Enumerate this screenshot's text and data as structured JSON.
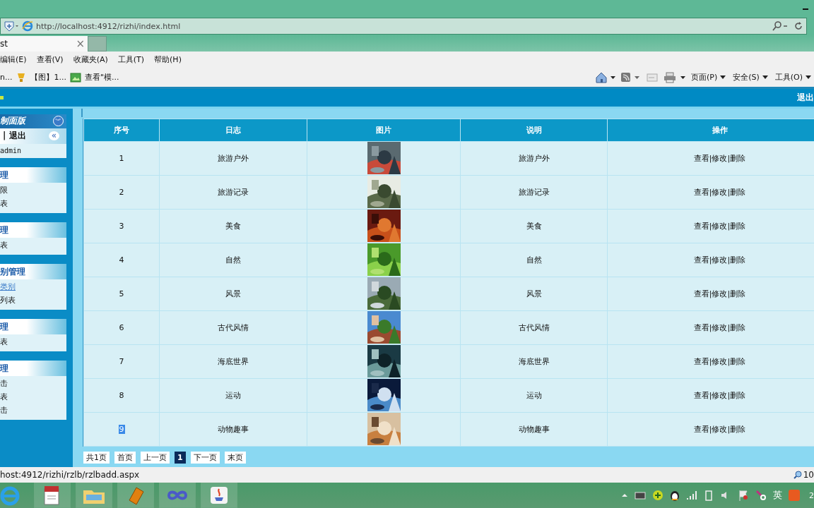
{
  "browser": {
    "url": "http://localhost:4912/rizhi/index.html",
    "tab": {
      "title": "st",
      "close": "×"
    },
    "menu": [
      "编辑(E)",
      "查看(V)",
      "收藏夹(A)",
      "工具(T)",
      "帮助(H)"
    ],
    "favorites": [
      "n...",
      "【图】1...",
      "查看\"模..."
    ],
    "commands": [
      "页面(P)",
      "安全(S)",
      "工具(O)"
    ]
  },
  "header": {
    "logout": "退出"
  },
  "sidebar": {
    "title": "制面版",
    "collapse": "︾",
    "user_links": "| 退出",
    "hide": "«",
    "user": "admin",
    "groups": [
      {
        "title": "理",
        "items": [
          {
            "label": "限",
            "link": false
          },
          {
            "label": "表",
            "link": false
          }
        ]
      },
      {
        "title": "理",
        "items": [
          {
            "label": "表",
            "link": false
          }
        ]
      },
      {
        "title": "别管理",
        "items": [
          {
            "label": "类别",
            "link": true
          },
          {
            "label": "列表",
            "link": false
          }
        ]
      },
      {
        "title": "理",
        "items": [
          {
            "label": "表",
            "link": false
          }
        ]
      },
      {
        "title": "理",
        "items": [
          {
            "label": "击",
            "link": false
          },
          {
            "label": "表",
            "link": false
          },
          {
            "label": "击",
            "link": false
          }
        ]
      }
    ]
  },
  "table": {
    "columns": [
      "序号",
      "日志",
      "图片",
      "说明",
      "操作"
    ],
    "rows": [
      {
        "no": "1",
        "log": "旅游户外",
        "note": "旅游户外",
        "actions": "查看|修改|删除",
        "selected": false
      },
      {
        "no": "2",
        "log": "旅游记录",
        "note": "旅游记录",
        "actions": "查看|修改|删除",
        "selected": false
      },
      {
        "no": "3",
        "log": "美食",
        "note": "美食",
        "actions": "查看|修改|删除",
        "selected": false
      },
      {
        "no": "4",
        "log": "自然",
        "note": "自然",
        "actions": "查看|修改|删除",
        "selected": false
      },
      {
        "no": "5",
        "log": "风景",
        "note": "风景",
        "actions": "查看|修改|删除",
        "selected": false
      },
      {
        "no": "6",
        "log": "古代风情",
        "note": "古代风情",
        "actions": "查看|修改|删除",
        "selected": false
      },
      {
        "no": "7",
        "log": "海底世界",
        "note": "海底世界",
        "actions": "查看|修改|删除",
        "selected": false
      },
      {
        "no": "8",
        "log": "运动",
        "note": "运动",
        "actions": "查看|修改|删除",
        "selected": false
      },
      {
        "no": "9",
        "log": "动物趣事",
        "note": "动物趣事",
        "actions": "查看|修改|删除",
        "selected": true
      }
    ]
  },
  "pager": [
    {
      "label": "共1页",
      "selected": false
    },
    {
      "label": "首页",
      "selected": false
    },
    {
      "label": "上一页",
      "selected": false
    },
    {
      "label": "1",
      "selected": true
    },
    {
      "label": "下一页",
      "selected": false
    },
    {
      "label": "末页",
      "selected": false
    }
  ],
  "status_bar": {
    "url": "host:4912/rizhi/rzlb/rzlbadd.aspx",
    "zoom": "10"
  },
  "taskbar": {
    "ime": "英",
    "clock": "2"
  }
}
